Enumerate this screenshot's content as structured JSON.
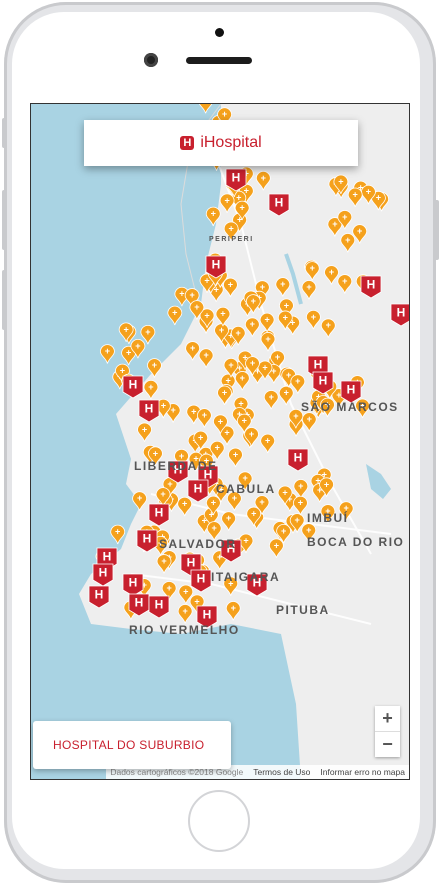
{
  "app": {
    "title": "iHospital",
    "logo_letter": "H"
  },
  "map": {
    "place_labels": [
      "SÃO MARCOS",
      "LIBERDADE",
      "CABULA",
      "IMBUÍ",
      "BOCA DO RIO",
      "RIO VERMELHO",
      "ITAIGARA",
      "PITUBA",
      "PERIPERI",
      "SALVADOR"
    ],
    "zoom_in_label": "+",
    "zoom_out_label": "−",
    "attribution": {
      "data": "Dados cartográficos ©2018 Google",
      "terms": "Termos de Uso",
      "report": "Informar erro no mapa"
    },
    "colors": {
      "water": "#a9d3e3",
      "land": "#eeeeee",
      "clinic_marker": "#f5a11c",
      "hospital_marker": "#c8202e"
    }
  },
  "selected_hospital": {
    "name": "HOSPITAL DO SUBURBIO"
  }
}
